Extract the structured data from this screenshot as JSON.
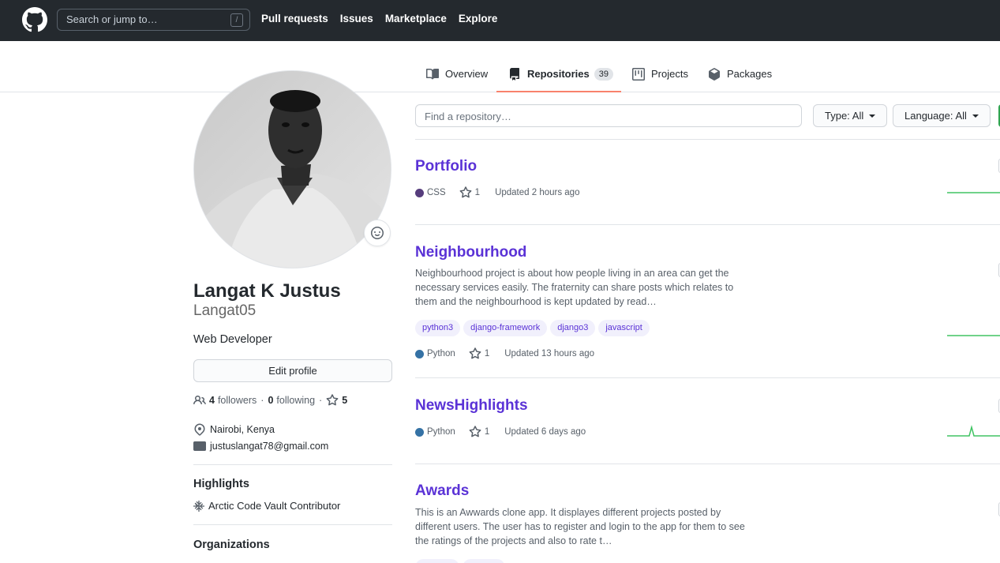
{
  "header": {
    "search_placeholder": "Search or jump to…",
    "search_shortcut": "/",
    "nav": [
      "Pull requests",
      "Issues",
      "Marketplace",
      "Explore"
    ]
  },
  "tabs": [
    {
      "label": "Overview",
      "icon": "book-icon"
    },
    {
      "label": "Repositories",
      "icon": "repo-icon",
      "count": "39",
      "selected": true
    },
    {
      "label": "Projects",
      "icon": "project-icon"
    },
    {
      "label": "Packages",
      "icon": "package-icon"
    }
  ],
  "profile": {
    "full_name": "Langat K Justus",
    "username": "Langat05",
    "bio": "Web Developer",
    "edit_button": "Edit profile",
    "followers_count": "4",
    "followers_label": "followers",
    "following_count": "0",
    "following_label": "following",
    "separator": "·",
    "stars_count": "5",
    "location": "Nairobi, Kenya",
    "email": "justuslangat78@gmail.com",
    "highlights_title": "Highlights",
    "highlight_item": "Arctic Code Vault Contributor",
    "organizations_title": "Organizations"
  },
  "filters": {
    "find_placeholder": "Find a repository…",
    "type_label": "Type:",
    "type_value": "All",
    "language_label": "Language:",
    "language_value": "All"
  },
  "colors": {
    "link": "#5a32d6",
    "css": "#563d7c",
    "python": "#3572A5",
    "tab_underline": "#f9826c",
    "spark": "#40c463"
  },
  "repos": [
    {
      "name": "Portfolio",
      "language": "CSS",
      "stars": "1",
      "updated": "Updated 2 hours ago"
    },
    {
      "name": "Neighbourhood",
      "description": "Neighbourhood project is about how people living in an area can get the necessary services easily. The fraternity can share posts which relates to them and the neighbourhood is kept updated by read…",
      "topics": [
        "python3",
        "django-framework",
        "django3",
        "javascript"
      ],
      "language": "Python",
      "stars": "1",
      "updated": "Updated 13 hours ago"
    },
    {
      "name": "NewsHighlights",
      "language": "Python",
      "stars": "1",
      "updated": "Updated 6 days ago"
    },
    {
      "name": "Awards",
      "description": "This is an Awwards clone app. It displayes different projects posted by different users. The user has to register and login to the app for them to see the ratings of the projects and also to rate t…"
    }
  ]
}
